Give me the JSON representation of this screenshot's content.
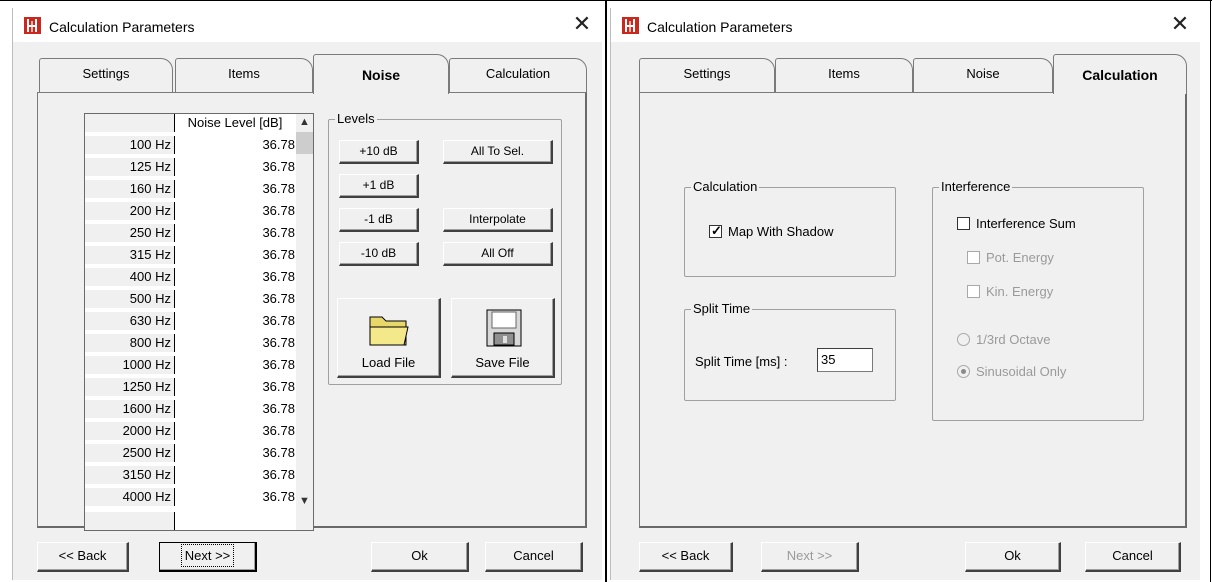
{
  "dialogs": [
    {
      "title": "Calculation Parameters",
      "tabs": [
        {
          "label": "Settings",
          "active": false
        },
        {
          "label": "Items",
          "active": false
        },
        {
          "label": "Noise",
          "active": true
        },
        {
          "label": "Calculation",
          "active": false
        }
      ],
      "buttons": {
        "back": "<< Back",
        "next": "Next >>",
        "ok": "Ok",
        "cancel": "Cancel"
      }
    },
    {
      "title": "Calculation Parameters",
      "tabs": [
        {
          "label": "Settings",
          "active": false
        },
        {
          "label": "Items",
          "active": false
        },
        {
          "label": "Noise",
          "active": false
        },
        {
          "label": "Calculation",
          "active": true
        }
      ],
      "buttons": {
        "back": "<< Back",
        "next": "Next >>",
        "ok": "Ok",
        "cancel": "Cancel"
      }
    }
  ],
  "noise_tab": {
    "table_header": "Noise Level [dB]",
    "rows": [
      {
        "freq": "100 Hz",
        "level": "36.78"
      },
      {
        "freq": "125 Hz",
        "level": "36.78"
      },
      {
        "freq": "160 Hz",
        "level": "36.78"
      },
      {
        "freq": "200 Hz",
        "level": "36.78"
      },
      {
        "freq": "250 Hz",
        "level": "36.78"
      },
      {
        "freq": "315 Hz",
        "level": "36.78"
      },
      {
        "freq": "400 Hz",
        "level": "36.78"
      },
      {
        "freq": "500 Hz",
        "level": "36.78"
      },
      {
        "freq": "630 Hz",
        "level": "36.78"
      },
      {
        "freq": "800 Hz",
        "level": "36.78"
      },
      {
        "freq": "1000 Hz",
        "level": "36.78"
      },
      {
        "freq": "1250 Hz",
        "level": "36.78"
      },
      {
        "freq": "1600 Hz",
        "level": "36.78"
      },
      {
        "freq": "2000 Hz",
        "level": "36.78"
      },
      {
        "freq": "2500 Hz",
        "level": "36.78"
      },
      {
        "freq": "3150 Hz",
        "level": "36.78"
      },
      {
        "freq": "4000 Hz",
        "level": "36.78"
      }
    ],
    "levels_group": "Levels",
    "level_buttons": {
      "plus10": "+10 dB",
      "all_to_sel": "All To Sel.",
      "plus1": "+1 dB",
      "minus1": "-1 dB",
      "interpolate": "Interpolate",
      "minus10": "-10 dB",
      "all_off": "All Off"
    },
    "load_file": "Load File",
    "save_file": "Save File"
  },
  "calc_tab": {
    "calculation_group": "Calculation",
    "map_with_shadow": {
      "label": "Map With Shadow",
      "checked": true
    },
    "split_group": "Split Time",
    "split_label": "Split Time [ms] :",
    "split_value": "35",
    "interference_group": "Interference",
    "interference_sum": {
      "label": "Interference Sum",
      "checked": false
    },
    "pot_energy": {
      "label": "Pot. Energy",
      "checked": false
    },
    "kin_energy": {
      "label": "Kin. Energy",
      "checked": false
    },
    "third_octave": {
      "label": "1/3rd Octave",
      "selected": false
    },
    "sinusoidal_only": {
      "label": "Sinusoidal Only",
      "selected": true
    }
  },
  "colors": {
    "dialog_bg": "#f0f0f0",
    "app_icon": "#c8281e"
  }
}
